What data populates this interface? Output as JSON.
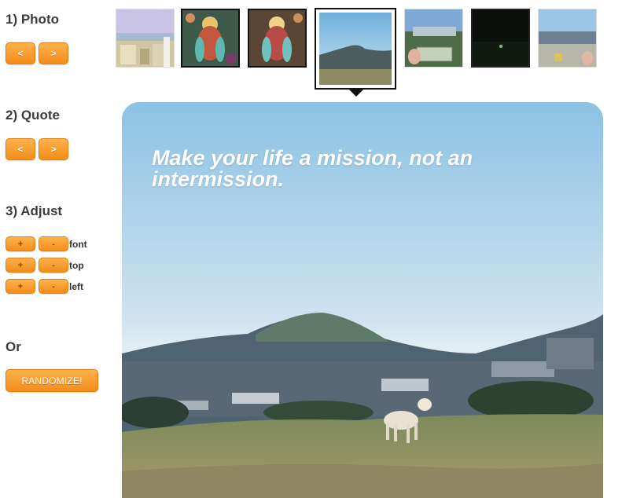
{
  "steps": {
    "photo": "1) Photo",
    "quote": "2) Quote",
    "adjust": "3) Adjust",
    "or": "Or"
  },
  "nav": {
    "prev": "<",
    "next": ">"
  },
  "adjust": {
    "plus": "+",
    "minus": "-",
    "rows": [
      "font",
      "top",
      "left"
    ]
  },
  "randomize": "RANDOMIZE!",
  "quote_text": "Make your life a mission, not an intermission.",
  "thumbnails": [
    {
      "name": "rooftop-city"
    },
    {
      "name": "colorful-art-1"
    },
    {
      "name": "colorful-art-2"
    },
    {
      "name": "hill-with-dog",
      "selected": true
    },
    {
      "name": "dollar-bill-view"
    },
    {
      "name": "night-scene"
    },
    {
      "name": "city-hill-view"
    }
  ],
  "colors": {
    "button_orange": "#f7931e",
    "text_dark": "#3c3c3c",
    "sky_blue": "#8cc2e4"
  }
}
